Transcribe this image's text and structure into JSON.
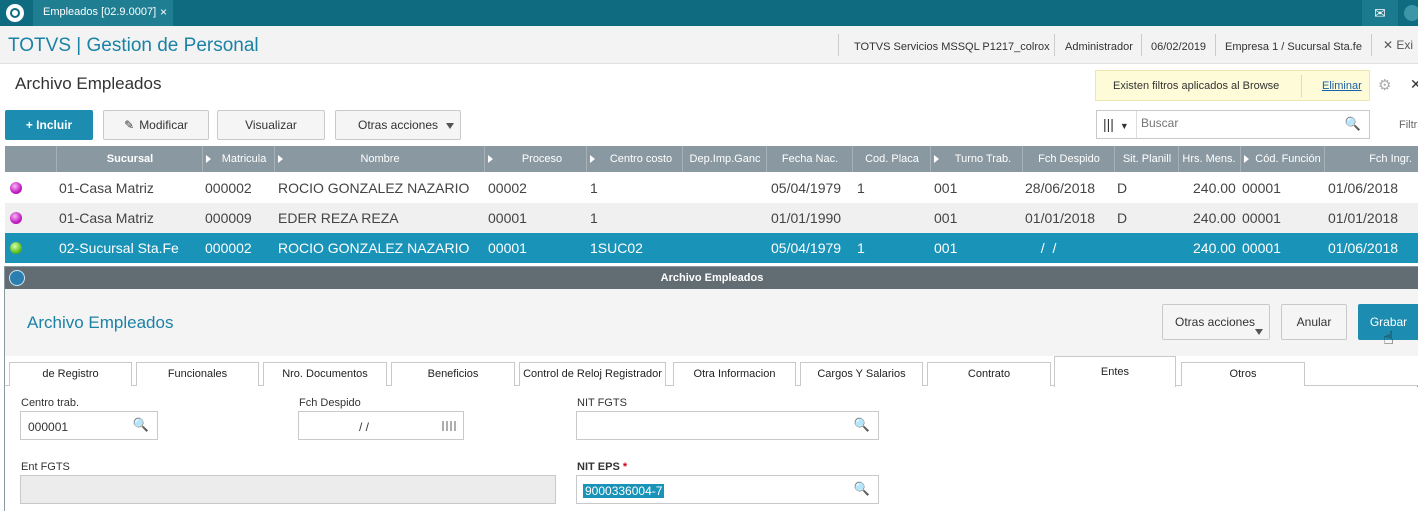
{
  "topbar": {
    "tab_label": "Empleados [02.9.0007]",
    "tab_close": "×",
    "mail_icon": "✉"
  },
  "app": {
    "title": "TOTVS | Gestion de Personal",
    "server": "TOTVS Servicios MSSQL P1217_colrox",
    "user": "Administrador",
    "date": "06/02/2019",
    "company": "Empresa 1 / Sucursal Sta.fe",
    "exit": "✕ Exi"
  },
  "page": {
    "title": "Archivo Empleados",
    "filter_message": "Existen filtros aplicados al Browse",
    "filter_remove": "Eliminar",
    "filter_label": "Filtra"
  },
  "toolbar": {
    "include": "+ Incluir",
    "modify": "Modificar",
    "view": "Visualizar",
    "other": "Otras acciones"
  },
  "search": {
    "placeholder": "Buscar",
    "value": "Buscar"
  },
  "grid": {
    "headers": [
      "Sucursal",
      "Matricula",
      "Nombre",
      "Proceso",
      "Centro costo",
      "Dep.Imp.Ganc",
      "Fecha Nac.",
      "Cod. Placa",
      "Turno Trab.",
      "Fch Despido",
      "Sit. Planill",
      "Hrs. Mens.",
      "Cód. Función",
      "Fch Ingr."
    ],
    "rows": [
      {
        "status": "pink",
        "cells": [
          "01-Casa Matriz",
          "000002",
          "ROCIO  GONZALEZ NAZARIO",
          "00002",
          "1",
          "",
          "05/04/1979",
          "1",
          "001",
          "28/06/2018",
          "D",
          "240.00",
          "00001",
          "01/06/2018"
        ]
      },
      {
        "status": "pink",
        "cells": [
          "01-Casa Matriz",
          "000009",
          "EDER  REZA REZA",
          "00001",
          "1",
          "",
          "01/01/1990",
          "",
          "001",
          "01/01/2018",
          "D",
          "240.00",
          "00001",
          "01/01/2018"
        ]
      },
      {
        "status": "green",
        "cells": [
          "02-Sucursal Sta.Fe",
          "000002",
          "ROCIO  GONZALEZ NAZARIO",
          "00001",
          "1SUC02",
          "",
          "05/04/1979",
          "1",
          "001",
          "  /  /",
          "",
          "240.00",
          "00001",
          "01/06/2018"
        ]
      }
    ]
  },
  "modal": {
    "bar_title": "Archivo Empleados",
    "title": "Archivo Empleados",
    "other_actions": "Otras acciones",
    "cancel": "Anular",
    "save": "Grabar",
    "tabs": [
      "de Registro",
      "Funcionales",
      "Nro. Documentos",
      "Beneficios",
      "Control de Reloj Registrador",
      "Otra Informacion",
      "Cargos Y Salarios",
      "Contrato",
      "Entes",
      "Otros"
    ],
    "active_tab": "Entes",
    "fields": {
      "centro_trab_label": "Centro trab.",
      "centro_trab_value": "000001",
      "fch_despido_label": "Fch Despido",
      "fch_despido_value": "/ /",
      "nit_fgts_label": "NIT FGTS",
      "nit_fgts_value": "",
      "ent_fgts_label": "Ent FGTS",
      "nit_eps_label": "NIT EPS",
      "nit_eps_required": "*",
      "nit_eps_value": "9000336004-7"
    }
  },
  "colors": {
    "topbar": "#0f6b7f",
    "accent": "#1c8cb1",
    "grid_header": "#8a99a1",
    "selected_row": "#1993b7"
  }
}
